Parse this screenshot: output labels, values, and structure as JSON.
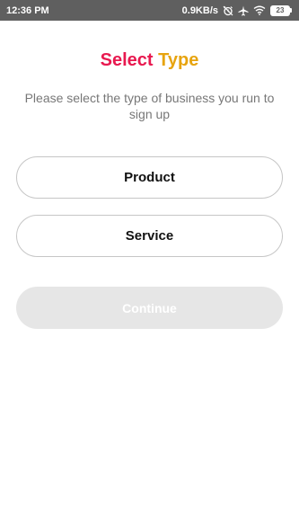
{
  "status_bar": {
    "time": "12:36 PM",
    "network_speed": "0.9KB/s",
    "icons": [
      "alarm-off-icon",
      "airplane-icon",
      "wifi-icon"
    ],
    "battery_level": "23"
  },
  "header": {
    "title_part1": "Select",
    "title_part2": "Type",
    "title_colors": {
      "part1": "#e8194f",
      "part2": "#e7a40f"
    },
    "subtitle": "Please select the type of business you run to sign up"
  },
  "options": [
    {
      "label": "Product"
    },
    {
      "label": "Service"
    }
  ],
  "continue_button": {
    "label": "Continue",
    "state": "disabled"
  }
}
